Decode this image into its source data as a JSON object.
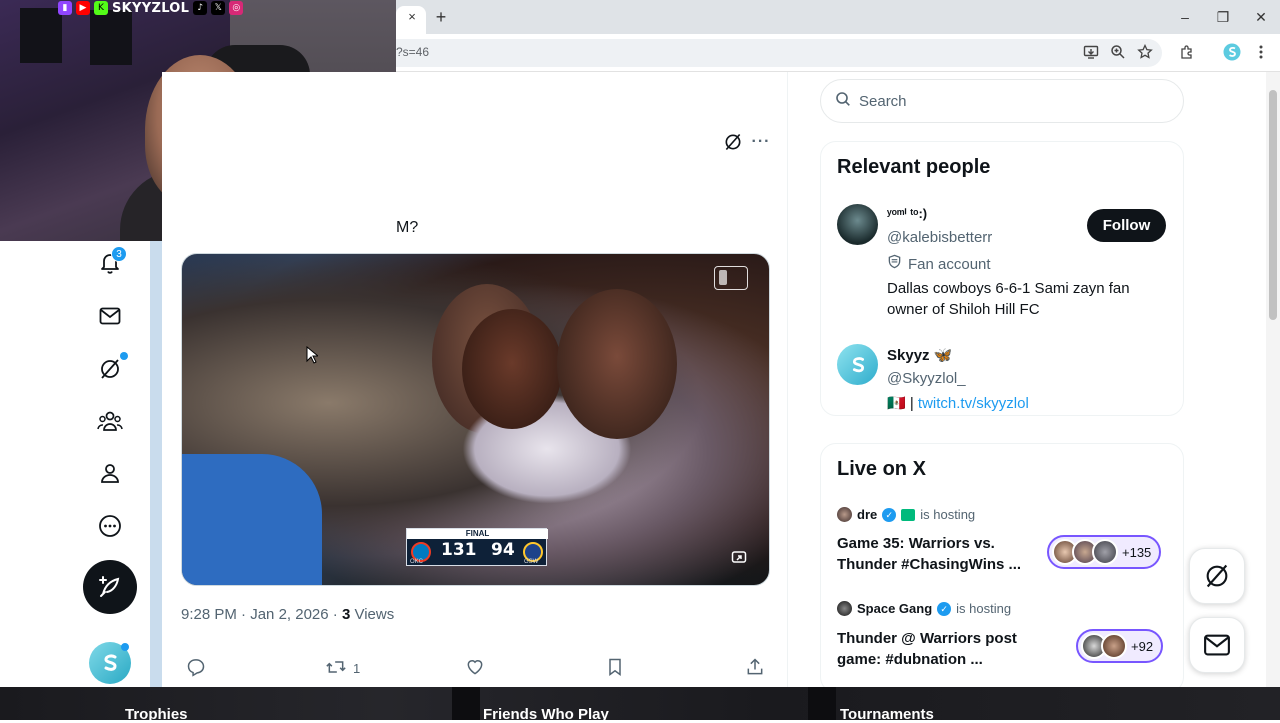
{
  "browser": {
    "tab_close": "×",
    "new_tab": "+",
    "url": "?s=46",
    "win_minimize": "–",
    "win_restore": "❐",
    "win_close": "✕"
  },
  "overlay": {
    "streamer_handle": "SKYYZLOL"
  },
  "nav": {
    "notifications_badge": "3"
  },
  "tweet": {
    "text_tail": "M?",
    "more": "···",
    "scoreboard": {
      "label": "FINAL",
      "home_score": "131",
      "away_score": "94",
      "home_abbr": "OKC",
      "away_abbr": "GSW"
    },
    "time": "9:28 PM",
    "date": "Jan 2, 2026",
    "views_count": "3",
    "views_label": "Views",
    "retweets": "1"
  },
  "search": {
    "placeholder": "Search"
  },
  "relevant_people": {
    "title": "Relevant people",
    "follow_label": "Follow",
    "people": [
      {
        "name": "ʸᵒᵐⁱ ᵗᵒ:)",
        "handle": "@kalebisbetterr",
        "label": "Fan account",
        "bio_line1": "Dallas cowboys 6-6-1 Sami zayn fan",
        "bio_line2": "owner of Shiloh Hill FC"
      },
      {
        "name": "Skyyz 🦋",
        "handle": "@Skyyzlol_",
        "bio_prefix": "🇲🇽 | ",
        "bio_link": "twitch.tv/skyyzlol"
      }
    ]
  },
  "live": {
    "title": "Live on X",
    "spaces": [
      {
        "host": "dre",
        "hosting_label": "is hosting",
        "title_line1": "Game 35: Warriors vs.",
        "title_line2": "Thunder #ChasingWins ...",
        "listeners": "+135"
      },
      {
        "host": "Space Gang",
        "hosting_label": "is hosting",
        "title_line1": "Thunder @ Warriors post",
        "title_line2": "game: #dubnation ...",
        "listeners": "+92"
      }
    ]
  },
  "bottom_strip": {
    "items": [
      "Trophies",
      "Friends Who Play",
      "Tournaments"
    ]
  },
  "colors": {
    "accent": "#1d9bf0",
    "text": "#0f1419",
    "muted": "#536471",
    "live_border": "#7856ff"
  }
}
